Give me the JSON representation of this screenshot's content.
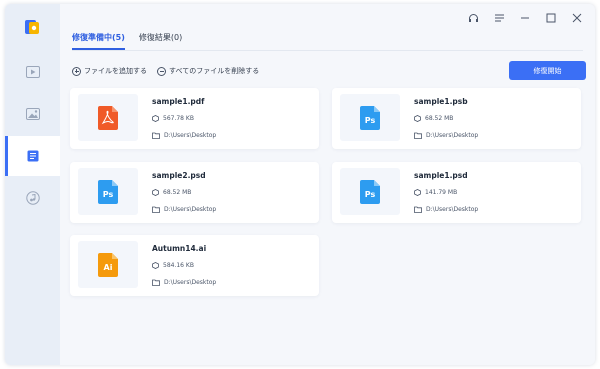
{
  "tabs": [
    {
      "label": "修復準備中(5)",
      "active": true
    },
    {
      "label": "修復結果(0)",
      "active": false
    }
  ],
  "toolbar": {
    "add_files": "ファイルを追加する",
    "delete_all": "すべてのファイルを削除する",
    "start_repair": "修復開始"
  },
  "sidebar": {
    "items": [
      {
        "icon": "video-icon",
        "active": false
      },
      {
        "icon": "photo-icon",
        "active": false
      },
      {
        "icon": "document-icon",
        "active": true
      },
      {
        "icon": "music-icon",
        "active": false
      }
    ]
  },
  "window_controls": [
    "headset-icon",
    "menu-icon",
    "minimize-icon",
    "maximize-icon",
    "close-icon"
  ],
  "files": [
    {
      "name": "sample1.pdf",
      "size": "567.78 KB",
      "path": "D:\\Users\\Desktop",
      "type": "pdf",
      "icon_text": "",
      "color": "#f05a28"
    },
    {
      "name": "sample1.psb",
      "size": "68.52 MB",
      "path": "D:\\Users\\Desktop",
      "type": "ps",
      "icon_text": "Ps",
      "color": "#2d9cf0"
    },
    {
      "name": "sample2.psd",
      "size": "68.52 MB",
      "path": "D:\\Users\\Desktop",
      "type": "ps",
      "icon_text": "Ps",
      "color": "#2d9cf0"
    },
    {
      "name": "sample1.psd",
      "size": "141.79 MB",
      "path": "D:\\Users\\Desktop",
      "type": "ps",
      "icon_text": "Ps",
      "color": "#2d9cf0"
    },
    {
      "name": "Autumn14.ai",
      "size": "584.16 KB",
      "path": "D:\\Users\\Desktop",
      "type": "ai",
      "icon_text": "Ai",
      "color": "#f59a0c"
    }
  ],
  "colors": {
    "accent": "#3b6ff5"
  }
}
